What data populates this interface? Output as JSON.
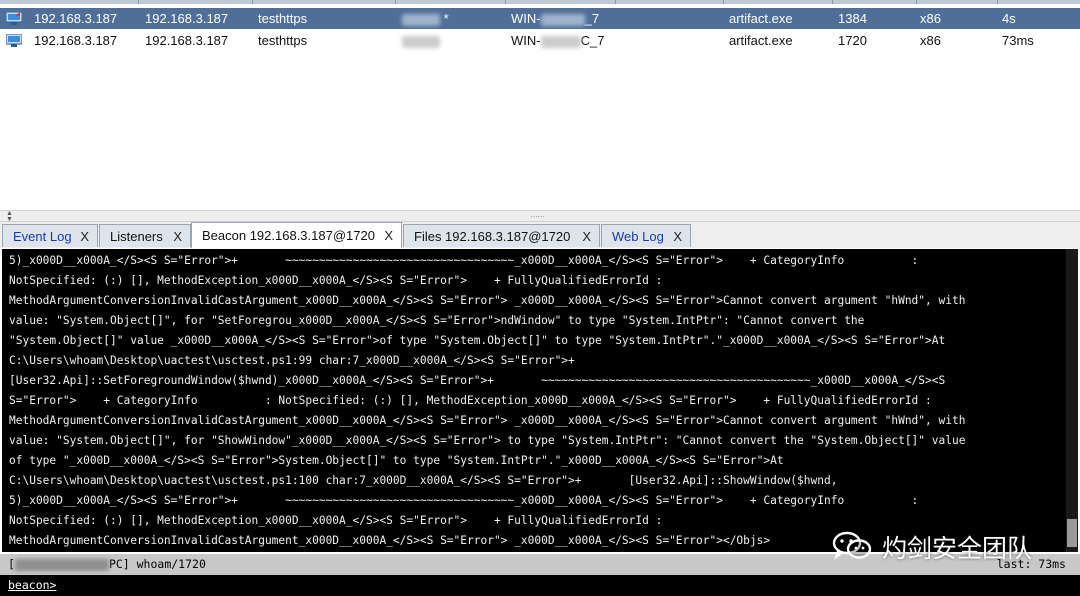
{
  "sessions": {
    "rows": [
      {
        "external": "192.168.3.187",
        "internal": "192.168.3.187",
        "listener": "testhttps",
        "user_suffix": " *",
        "computer_prefix": "WIN-",
        "computer_suffix": "_7",
        "process": "artifact.exe",
        "pid": "1384",
        "arch": "x86",
        "last": "4s"
      },
      {
        "external": "192.168.3.187",
        "internal": "192.168.3.187",
        "listener": "testhttps",
        "user_suffix": "",
        "computer_prefix": "WIN-",
        "computer_suffix": "C_7",
        "process": "artifact.exe",
        "pid": "1720",
        "arch": "x86",
        "last": "73ms"
      }
    ]
  },
  "tabs": [
    {
      "label": "Event Log",
      "close": "X"
    },
    {
      "label": "Listeners",
      "close": "X"
    },
    {
      "label": "Beacon 192.168.3.187@1720",
      "close": "X"
    },
    {
      "label": "Files 192.168.3.187@1720",
      "close": "X"
    },
    {
      "label": "Web Log",
      "close": "X"
    }
  ],
  "console": {
    "lines": [
      "5)_x000D__x000A_</S><S S=\"Error\">+       ~~~~~~~~~~~~~~~~~~~~~~~~~~~~~~~~~~_x000D__x000A_</S><S S=\"Error\">    + CategoryInfo          :",
      "NotSpecified: (:) [], MethodException_x000D__x000A_</S><S S=\"Error\">    + FullyQualifiedErrorId :",
      "MethodArgumentConversionInvalidCastArgument_x000D__x000A_</S><S S=\"Error\"> _x000D__x000A_</S><S S=\"Error\">Cannot convert argument \"hWnd\", with",
      "value: \"System.Object[]\", for \"SetForegrou_x000D__x000A_</S><S S=\"Error\">ndWindow\" to type \"System.IntPtr\": \"Cannot convert the",
      "\"System.Object[]\" value _x000D__x000A_</S><S S=\"Error\">of type \"System.Object[]\" to type \"System.IntPtr\".\"_x000D__x000A_</S><S S=\"Error\">At",
      "C:\\Users\\whoam\\Desktop\\uactest\\usctest.ps1:99 char:7_x000D__x000A_</S><S S=\"Error\">+",
      "[User32.Api]::SetForegroundWindow($hwnd)_x000D__x000A_</S><S S=\"Error\">+       ~~~~~~~~~~~~~~~~~~~~~~~~~~~~~~~~~~~~~~~~_x000D__x000A_</S><S",
      "S=\"Error\">    + CategoryInfo          : NotSpecified: (:) [], MethodException_x000D__x000A_</S><S S=\"Error\">    + FullyQualifiedErrorId :",
      "MethodArgumentConversionInvalidCastArgument_x000D__x000A_</S><S S=\"Error\"> _x000D__x000A_</S><S S=\"Error\">Cannot convert argument \"hWnd\", with",
      "value: \"System.Object[]\", for \"ShowWindow\"_x000D__x000A_</S><S S=\"Error\"> to type \"System.IntPtr\": \"Cannot convert the \"System.Object[]\" value",
      "of type \"_x000D__x000A_</S><S S=\"Error\">System.Object[]\" to type \"System.IntPtr\".\"_x000D__x000A_</S><S S=\"Error\">At",
      "C:\\Users\\whoam\\Desktop\\uactest\\usctest.ps1:100 char:7_x000D__x000A_</S><S S=\"Error\">+       [User32.Api]::ShowWindow($hwnd,",
      "5)_x000D__x000A_</S><S S=\"Error\">+       ~~~~~~~~~~~~~~~~~~~~~~~~~~~~~~~~~~_x000D__x000A_</S><S S=\"Error\">    + CategoryInfo          :",
      "NotSpecified: (:) [], MethodException_x000D__x000A_</S><S S=\"Error\">    + FullyQualifiedErrorId :",
      "MethodArgumentConversionInvalidCastArgument_x000D__x000A_</S><S S=\"Error\"> _x000D__x000A_</S><S S=\"Error\"></Objs>"
    ]
  },
  "status": {
    "left_prefix": "[",
    "left_suffix": "PC] whoam/1720",
    "right": "last: 73ms"
  },
  "command": {
    "prompt": "beacon>",
    "value": ""
  },
  "watermark": {
    "text": "灼剑安全团队"
  },
  "colors": {
    "selected_row": "#4f6f98",
    "console_bg": "#000000",
    "tab_link": "#1438b8",
    "status_bg": "#c8c8c8"
  }
}
